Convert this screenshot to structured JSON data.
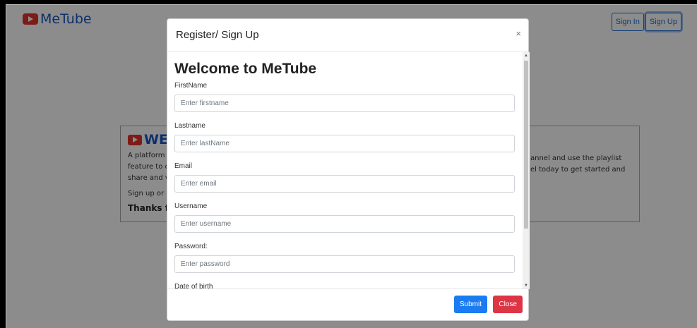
{
  "app": {
    "logo_text": "MeTube",
    "sign_in": "Sign In",
    "sign_up": "Sign Up"
  },
  "background": {
    "welcome_title": "WEL",
    "text_lines": [
      "A platform v",
      "feature to cr",
      "share and vi"
    ],
    "right_lines": [
      "annel and use the playlist",
      "el today to get started and"
    ],
    "signup_line": "Sign up or S",
    "thanks": "Thanks fo"
  },
  "modal": {
    "title": "Register/ Sign Up",
    "close_icon": "×",
    "heading": "Welcome to MeTube",
    "fields": [
      {
        "label": "FirstName",
        "placeholder": "Enter firstname"
      },
      {
        "label": "Lastname",
        "placeholder": "Enter lastName"
      },
      {
        "label": "Email",
        "placeholder": "Enter email"
      },
      {
        "label": "Username",
        "placeholder": "Enter username"
      },
      {
        "label": "Password:",
        "placeholder": "Enter password"
      }
    ],
    "dob_label": "Date of birth",
    "submit_label": "Submit",
    "close_label": "Close"
  },
  "colors": {
    "brand_blue": "#1a56c4",
    "youtube_red": "#e4322b",
    "submit_blue": "#1a7cf0",
    "close_red": "#dc3545"
  }
}
